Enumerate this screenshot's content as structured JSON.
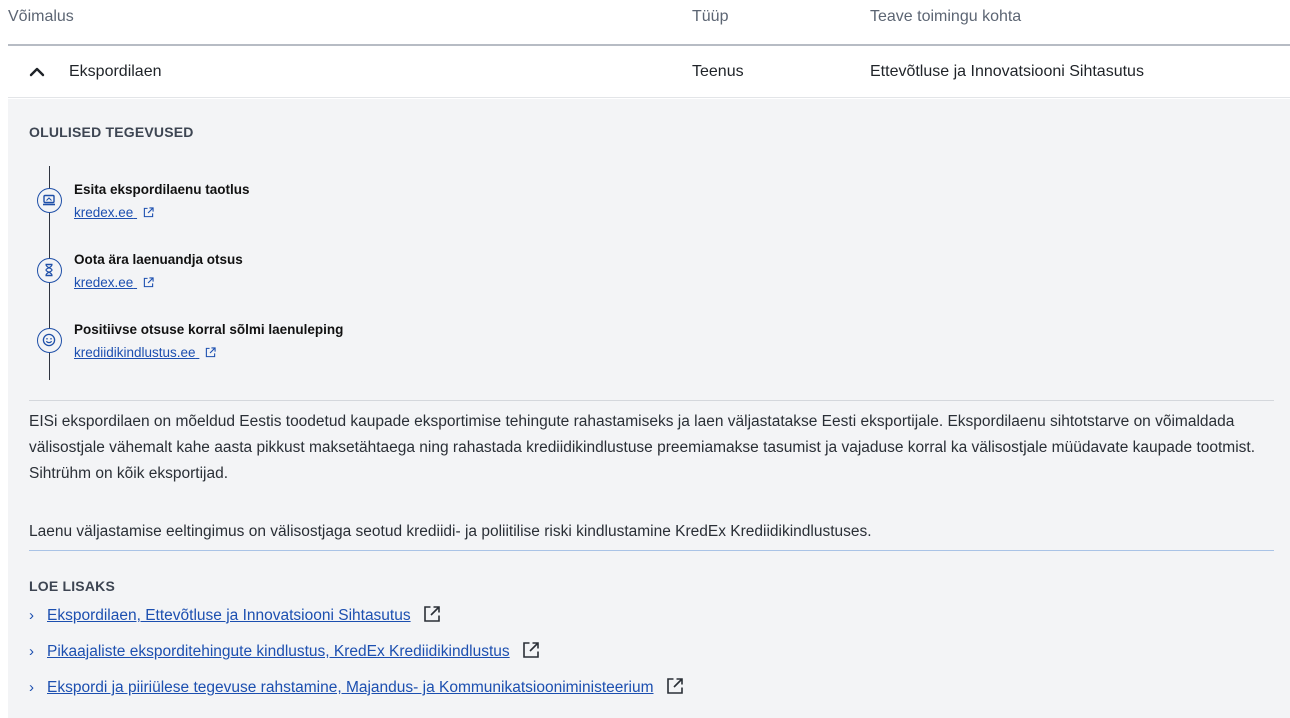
{
  "table": {
    "headers": [
      "Võimalus",
      "Tüüp",
      "Teave toimingu kohta"
    ],
    "row": {
      "name": "Ekspordilaen",
      "type": "Teenus",
      "info": "Ettevõtluse ja Innovatsiooni Sihtasutus"
    }
  },
  "panel": {
    "activities_title": "OLULISED TEGEVUSED",
    "steps": [
      {
        "title": "Esita ekspordilaenu taotlus",
        "link": "kredex.ee",
        "icon": "laptop-icon"
      },
      {
        "title": "Oota ära laenuandja otsus",
        "link": "kredex.ee",
        "icon": "hourglass-icon"
      },
      {
        "title": "Positiivse otsuse korral sõlmi laenuleping",
        "link": "krediidikindlustus.ee",
        "icon": "smiley-icon"
      }
    ],
    "description_1": "EISi ekspordilaen on mõeldud Eestis toodetud kaupade eksportimise tehingute rahastamiseks ja laen väljastatakse Eesti eksportijale. Ekspordilaenu sihtotstarve on võimaldada välisostjale vähemalt kahe aasta pikkust maksetähtaega ning rahastada krediidikindlustuse preemiamakse tasumist ja vajaduse korral ka välisostjale müüdavate kaupade tootmist. Sihtrühm on kõik eksportijad.",
    "description_2": "Laenu väljastamise eeltingimus on välisostjaga seotud krediidi- ja poliitilise riski kindlustamine KredEx Krediidikindlustuses.",
    "read_more_title": "LOE LISAKS",
    "read_more": [
      "Ekspordilaen, Ettevõtluse ja Innovatsiooni Sihtasutus",
      "Pikaajaliste eksporditehingute kindlustus, KredEx Krediidikindlustus",
      "Ekspordi ja piiriülese tegevuse rahstamine, Majandus- ja Kommunikatsiooniministeerium"
    ]
  },
  "colors": {
    "link": "#1c4fb0",
    "panel_bg": "#f3f4f6",
    "header_border": "#b7bcc4"
  }
}
